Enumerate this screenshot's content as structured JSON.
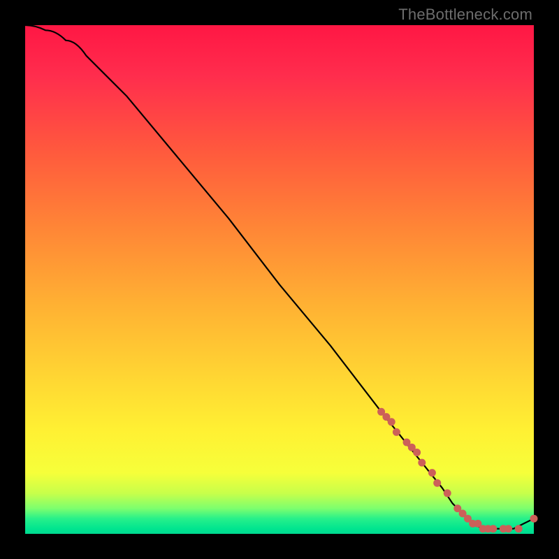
{
  "watermark": "TheBottleneck.com",
  "chart_data": {
    "type": "line",
    "title": "",
    "xlabel": "",
    "ylabel": "",
    "xlim": [
      0,
      100
    ],
    "ylim": [
      0,
      100
    ],
    "grid": false,
    "legend": false,
    "series": [
      {
        "name": "bottleneck-curve",
        "x": [
          0,
          4,
          8,
          12,
          16,
          20,
          30,
          40,
          50,
          60,
          70,
          74,
          78,
          82,
          84,
          86,
          88,
          90,
          92,
          94,
          96,
          98,
          100
        ],
        "y": [
          100,
          99,
          97,
          94,
          90,
          86,
          74,
          62,
          49,
          37,
          24,
          19,
          14,
          9,
          6,
          4,
          2,
          1,
          1,
          1,
          1,
          2,
          3
        ]
      }
    ],
    "scatter_points": {
      "name": "sampled-data-points",
      "x": [
        70,
        71,
        72,
        73,
        75,
        76,
        77,
        78,
        80,
        81,
        83,
        85,
        86,
        87,
        88,
        89,
        90,
        91,
        92,
        94,
        95,
        97,
        100
      ],
      "y": [
        24,
        23,
        22,
        20,
        18,
        17,
        16,
        14,
        12,
        10,
        8,
        5,
        4,
        3,
        2,
        2,
        1,
        1,
        1,
        1,
        1,
        1,
        3
      ]
    },
    "background_gradient": {
      "orientation": "vertical",
      "stops": [
        {
          "pos": 0.0,
          "color": "#ff1744"
        },
        {
          "pos": 0.4,
          "color": "#ff8636"
        },
        {
          "pos": 0.8,
          "color": "#fff133"
        },
        {
          "pos": 0.97,
          "color": "#27f08a"
        },
        {
          "pos": 1.0,
          "color": "#00d990"
        }
      ]
    }
  }
}
